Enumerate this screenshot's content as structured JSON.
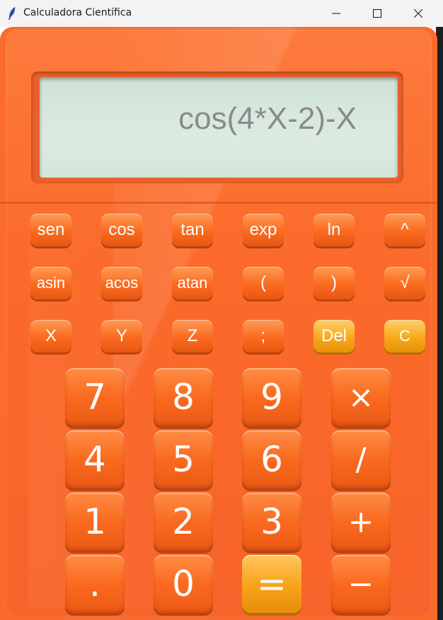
{
  "window": {
    "title": "Calculadora Científica",
    "minimize_label": "Minimize",
    "maximize_label": "Maximize",
    "close_label": "Close"
  },
  "display": {
    "expression": "cos(4*X-2)-X"
  },
  "function_rows": [
    [
      "sen",
      "cos",
      "tan",
      "exp",
      "ln",
      "^"
    ],
    [
      "asin",
      "acos",
      "atan",
      "(",
      ")",
      "√"
    ],
    [
      "X",
      "Y",
      "Z",
      ";",
      "Del",
      "C"
    ]
  ],
  "keypad_rows": [
    [
      "7",
      "8",
      "9",
      "×"
    ],
    [
      "4",
      "5",
      "6",
      "/"
    ],
    [
      "1",
      "2",
      "3",
      "+"
    ],
    [
      ".",
      "0",
      "=",
      "−"
    ]
  ],
  "colors": {
    "body": "#fb6b2b",
    "display": "#dcebe2",
    "accent_yellow": "#f9a819"
  }
}
